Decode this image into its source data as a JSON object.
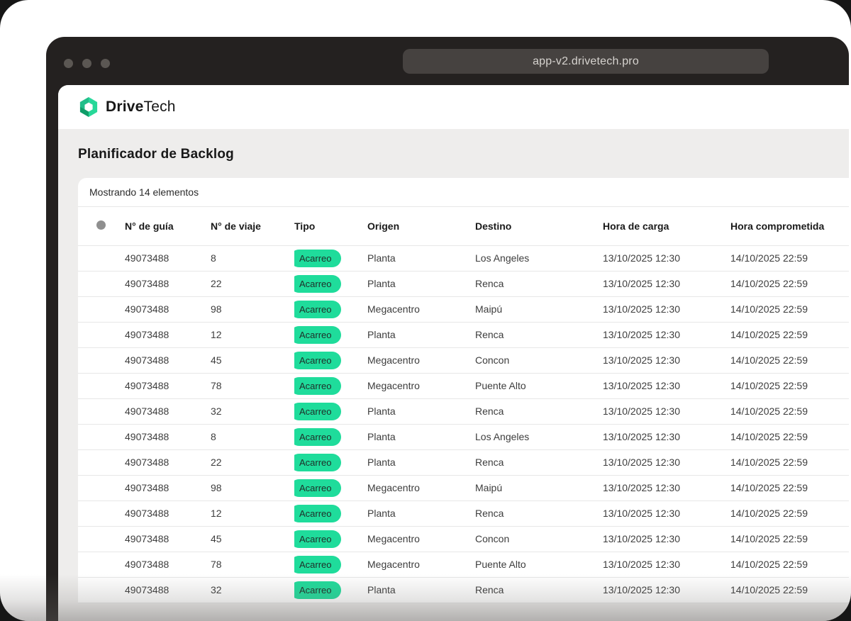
{
  "browser": {
    "url": "app-v2.drivetech.pro"
  },
  "brand": {
    "bold": "Drive",
    "light": "Tech"
  },
  "page": {
    "title": "Planificador de Backlog",
    "summary": "Mostrando 14 elementos"
  },
  "table": {
    "columns": [
      "N° de guía",
      "N° de viaje",
      "Tipo",
      "Origen",
      "Destino",
      "Hora de carga",
      "Hora comprometida"
    ],
    "rows": [
      {
        "guia": "49073488",
        "viaje": "8",
        "tipo": "Acarreo",
        "origen": "Planta",
        "destino": "Los Angeles",
        "carga": "13/10/2025 12:30",
        "comprometida": "14/10/2025 22:59"
      },
      {
        "guia": "49073488",
        "viaje": "22",
        "tipo": "Acarreo",
        "origen": "Planta",
        "destino": "Renca",
        "carga": "13/10/2025 12:30",
        "comprometida": "14/10/2025 22:59"
      },
      {
        "guia": "49073488",
        "viaje": "98",
        "tipo": "Acarreo",
        "origen": "Megacentro",
        "destino": "Maipú",
        "carga": "13/10/2025 12:30",
        "comprometida": "14/10/2025 22:59"
      },
      {
        "guia": "49073488",
        "viaje": "12",
        "tipo": "Acarreo",
        "origen": "Planta",
        "destino": "Renca",
        "carga": "13/10/2025 12:30",
        "comprometida": "14/10/2025 22:59"
      },
      {
        "guia": "49073488",
        "viaje": "45",
        "tipo": "Acarreo",
        "origen": "Megacentro",
        "destino": "Concon",
        "carga": "13/10/2025 12:30",
        "comprometida": "14/10/2025 22:59"
      },
      {
        "guia": "49073488",
        "viaje": "78",
        "tipo": "Acarreo",
        "origen": "Megacentro",
        "destino": "Puente Alto",
        "carga": "13/10/2025 12:30",
        "comprometida": "14/10/2025 22:59"
      },
      {
        "guia": "49073488",
        "viaje": "32",
        "tipo": "Acarreo",
        "origen": "Planta",
        "destino": "Renca",
        "carga": "13/10/2025 12:30",
        "comprometida": "14/10/2025 22:59"
      },
      {
        "guia": "49073488",
        "viaje": "8",
        "tipo": "Acarreo",
        "origen": "Planta",
        "destino": "Los Angeles",
        "carga": "13/10/2025 12:30",
        "comprometida": "14/10/2025 22:59"
      },
      {
        "guia": "49073488",
        "viaje": "22",
        "tipo": "Acarreo",
        "origen": "Planta",
        "destino": "Renca",
        "carga": "13/10/2025 12:30",
        "comprometida": "14/10/2025 22:59"
      },
      {
        "guia": "49073488",
        "viaje": "98",
        "tipo": "Acarreo",
        "origen": "Megacentro",
        "destino": "Maipú",
        "carga": "13/10/2025 12:30",
        "comprometida": "14/10/2025 22:59"
      },
      {
        "guia": "49073488",
        "viaje": "12",
        "tipo": "Acarreo",
        "origen": "Planta",
        "destino": "Renca",
        "carga": "13/10/2025 12:30",
        "comprometida": "14/10/2025 22:59"
      },
      {
        "guia": "49073488",
        "viaje": "45",
        "tipo": "Acarreo",
        "origen": "Megacentro",
        "destino": "Concon",
        "carga": "13/10/2025 12:30",
        "comprometida": "14/10/2025 22:59"
      },
      {
        "guia": "49073488",
        "viaje": "78",
        "tipo": "Acarreo",
        "origen": "Megacentro",
        "destino": "Puente Alto",
        "carga": "13/10/2025 12:30",
        "comprometida": "14/10/2025 22:59"
      },
      {
        "guia": "49073488",
        "viaje": "32",
        "tipo": "Acarreo",
        "origen": "Planta",
        "destino": "Renca",
        "carga": "13/10/2025 12:30",
        "comprometida": "14/10/2025 22:59"
      }
    ]
  },
  "colors": {
    "badge_bg": "#1fdc9b",
    "badge_text": "#1f2d28",
    "chrome": "#242120",
    "logo_green_dark": "#0f9d68",
    "logo_green_bright": "#27d898",
    "page_background": "#eeedec"
  }
}
